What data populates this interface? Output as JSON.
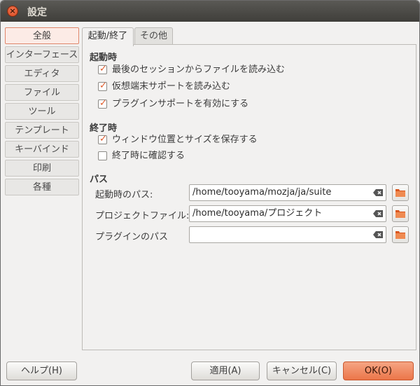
{
  "window": {
    "title": "設定",
    "close_glyph": "×"
  },
  "sidebar": {
    "items": [
      {
        "label": "全般",
        "active": true
      },
      {
        "label": "インターフェース"
      },
      {
        "label": "エディタ"
      },
      {
        "label": "ファイル"
      },
      {
        "label": "ツール"
      },
      {
        "label": "テンプレート"
      },
      {
        "label": "キーバインド"
      },
      {
        "label": "印刷"
      },
      {
        "label": "各種"
      }
    ]
  },
  "tabs": [
    {
      "label": "起動/終了",
      "active": true
    },
    {
      "label": "その他"
    }
  ],
  "startup": {
    "title": "起動時",
    "options": [
      {
        "label": "最後のセッションからファイルを読み込む",
        "checked": true
      },
      {
        "label": "仮想端末サポートを読み込む",
        "checked": true
      },
      {
        "label": "プラグインサポートを有効にする",
        "checked": true
      }
    ]
  },
  "shutdown": {
    "title": "終了時",
    "options": [
      {
        "label": "ウィンドウ位置とサイズを保存する",
        "checked": true
      },
      {
        "label": "終了時に確認する",
        "checked": false
      }
    ]
  },
  "paths": {
    "title": "パス",
    "fields": [
      {
        "label": "起動時のパス:",
        "value": "/home/tooyama/mozja/ja/suite"
      },
      {
        "label": "プロジェクトファイル:",
        "value": "/home/tooyama/プロジェクト"
      },
      {
        "label": "プラグインのパス",
        "value": ""
      }
    ]
  },
  "buttons": {
    "help": "ヘルプ(H)",
    "apply": "適用(A)",
    "cancel": "キャンセル(C)",
    "ok": "OK(O)"
  },
  "colors": {
    "accent": "#eb7549",
    "check": "#e15a29",
    "titlebar": "#3f3e3a"
  }
}
